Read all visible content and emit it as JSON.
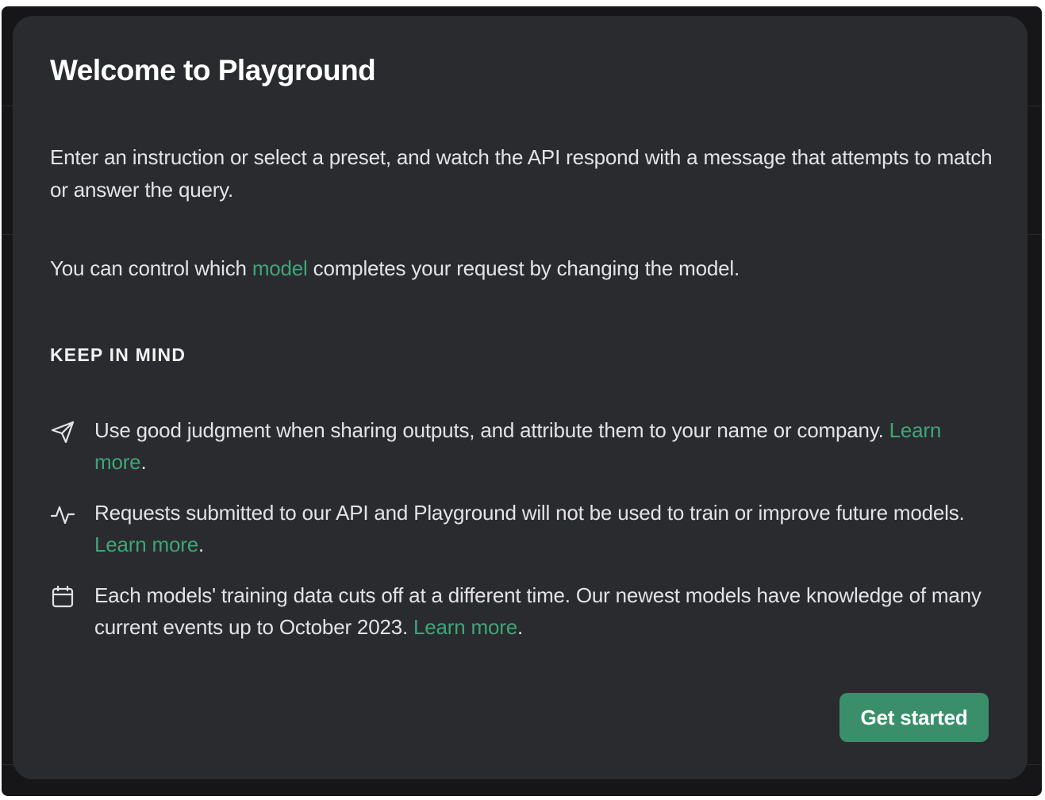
{
  "modal": {
    "title": "Welcome to Playground",
    "intro": "Enter an instruction or select a preset, and watch the API respond with a message that attempts to match or answer the query.",
    "model_text_before": "You can control which ",
    "model_link": "model",
    "model_text_after": " completes your request by changing the model.",
    "keep_in_mind_heading": "KEEP IN MIND",
    "items": [
      {
        "icon": "send-icon",
        "text": "Use good judgment when sharing outputs, and attribute them to your name or company. ",
        "link": "Learn more",
        "suffix": "."
      },
      {
        "icon": "activity-icon",
        "text": "Requests submitted to our API and Playground will not be used to train or improve future models. ",
        "link": "Learn more",
        "suffix": "."
      },
      {
        "icon": "calendar-icon",
        "text": "Each models' training data cuts off at a different time. Our newest models have knowledge of many current events up to October 2023. ",
        "link": "Learn more",
        "suffix": "."
      }
    ],
    "cta_label": "Get started"
  },
  "colors": {
    "modal_bg": "#2a2b2f",
    "backdrop": "#161618",
    "link": "#3fa57a",
    "button": "#3a8f6a"
  }
}
